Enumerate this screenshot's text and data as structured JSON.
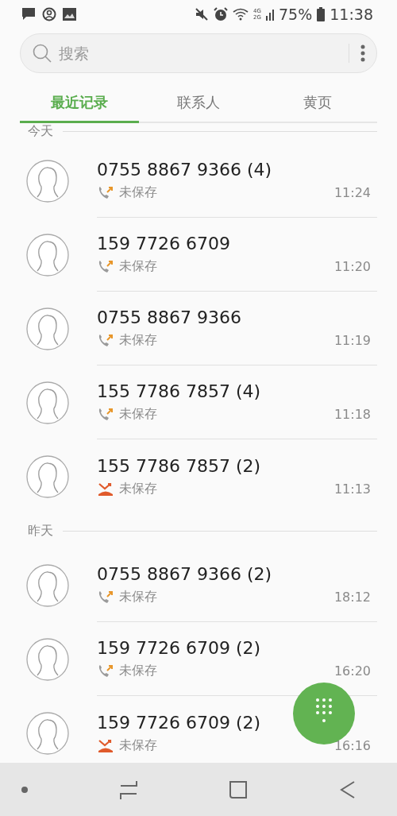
{
  "status_bar": {
    "network_labels": [
      "4G",
      "2G"
    ],
    "battery": "75%",
    "time": "11:38"
  },
  "search": {
    "placeholder": "搜索"
  },
  "tabs": [
    {
      "label": "最近记录",
      "selected": true
    },
    {
      "label": "联系人",
      "selected": false
    },
    {
      "label": "黄页",
      "selected": false
    }
  ],
  "sections": [
    {
      "header": "今天",
      "calls": [
        {
          "number": "0755 8867 9366 (4)",
          "kind": "outgoing",
          "status": "未保存",
          "time": "11:24"
        },
        {
          "number": "159 7726 6709",
          "kind": "outgoing",
          "status": "未保存",
          "time": "11:20"
        },
        {
          "number": "0755 8867 9366",
          "kind": "outgoing",
          "status": "未保存",
          "time": "11:19"
        },
        {
          "number": "155 7786 7857 (4)",
          "kind": "outgoing",
          "status": "未保存",
          "time": "11:18"
        },
        {
          "number": "155 7786 7857 (2)",
          "kind": "rejected",
          "status": "未保存",
          "time": "11:13"
        }
      ]
    },
    {
      "header": "昨天",
      "calls": [
        {
          "number": "0755 8867 9366 (2)",
          "kind": "outgoing",
          "status": "未保存",
          "time": "18:12"
        },
        {
          "number": "159 7726 6709 (2)",
          "kind": "outgoing",
          "status": "未保存",
          "time": "16:20"
        },
        {
          "number": "159 7726 6709 (2)",
          "kind": "rejected",
          "status": "未保存",
          "time": "16:16"
        }
      ]
    }
  ]
}
